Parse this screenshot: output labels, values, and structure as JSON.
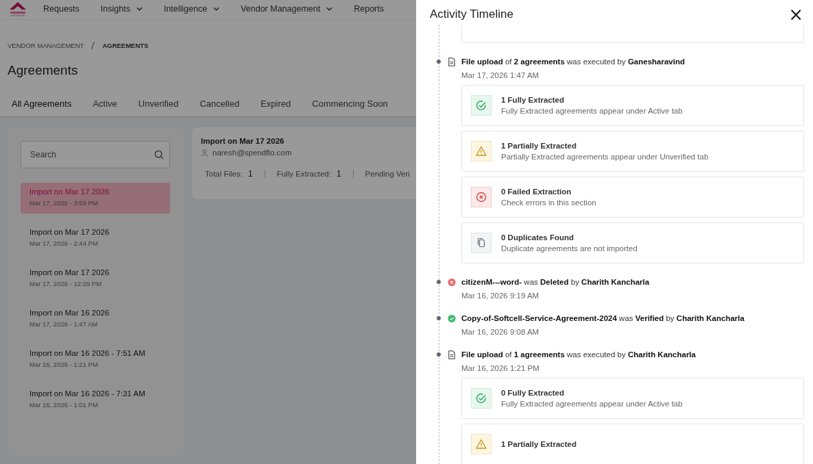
{
  "nav": {
    "items": [
      {
        "label": "Requests",
        "dropdown": false
      },
      {
        "label": "Insights",
        "dropdown": true
      },
      {
        "label": "Intelligence",
        "dropdown": true
      },
      {
        "label": "Vendor Management",
        "dropdown": true
      },
      {
        "label": "Reports",
        "dropdown": false
      }
    ]
  },
  "breadcrumb": [
    "VENDOR MANAGEMENT",
    "AGREEMENTS"
  ],
  "page_title": "Agreements",
  "tabs": [
    {
      "label": "All Agreements",
      "selected": true
    },
    {
      "label": "Active",
      "selected": false
    },
    {
      "label": "Unverified",
      "selected": false
    },
    {
      "label": "Cancelled",
      "selected": false
    },
    {
      "label": "Expired",
      "selected": false
    },
    {
      "label": "Commencing Soon",
      "selected": false
    }
  ],
  "search": {
    "placeholder": "Search"
  },
  "imports": [
    {
      "title": "Import on Mar 17 2026",
      "time": "Mar 17, 2026 - 3:59 PM",
      "selected": true
    },
    {
      "title": "Import on Mar 17 2026",
      "time": "Mar 17, 2026 - 2:44 PM",
      "selected": false
    },
    {
      "title": "Import on Mar 17 2026",
      "time": "Mar 17, 2026 - 12:29 PM",
      "selected": false
    },
    {
      "title": "Import on Mar 16 2026",
      "time": "Mar 17, 2026 - 1:47 AM",
      "selected": false
    },
    {
      "title": "Import on Mar 16 2026 - 7:51 AM",
      "time": "Mar 16, 2026 - 1:21 PM",
      "selected": false
    },
    {
      "title": "Import on Mar 16 2026 - 7:31 AM",
      "time": "Mar 16, 2026 - 1:01 PM",
      "selected": false
    }
  ],
  "detail": {
    "title": "Import on Mar 17 2026",
    "user": "naresh@spendflo.com",
    "stats": [
      {
        "label": "Total Files:",
        "value": "1"
      },
      {
        "label": "Fully Extracted:",
        "value": "1"
      },
      {
        "label": "Pending Veri"
      }
    ]
  },
  "drawer": {
    "title": "Activity Timeline",
    "close": "×",
    "events": [
      {
        "kind": "upload",
        "text": "**File upload** of **2 agreements** was executed by **Ganesharavind**",
        "time": "Mar 17, 2026 1:47 AM",
        "results": [
          {
            "kind": "success",
            "title": "1 Fully Extracted",
            "desc": "Fully Extracted agreements appear under Active tab"
          },
          {
            "kind": "partial",
            "title": "1 Partially Extracted",
            "desc": "Partially Extracted agreements appear under Unverified tab"
          },
          {
            "kind": "failed",
            "title": "0 Failed Extraction",
            "desc": "Check errors in this section"
          },
          {
            "kind": "duplicate",
            "title": "0 Duplicates Found",
            "desc": "Duplicate agreements are not imported"
          }
        ]
      },
      {
        "kind": "deleted",
        "text": "**citizenM---word-** was **Deleted** by **Charith Kancharla**",
        "time": "Mar 16, 2026 9:19 AM"
      },
      {
        "kind": "verified",
        "text": "**Copy-of-Softcell-Service-Agreement-2024** was **Verified** by **Charith Kancharla**",
        "time": "Mar 16, 2026 9:08 AM"
      },
      {
        "kind": "upload",
        "text": "**File upload** of **1 agreements** was executed by **Charith Kancharla**",
        "time": "Mar 16, 2026 1:21 PM",
        "results": [
          {
            "kind": "success",
            "title": "0 Fully Extracted",
            "desc": "Fully Extracted agreements appear under Active tab"
          },
          {
            "kind": "partial",
            "title": "1 Partially Extracted"
          }
        ]
      }
    ]
  }
}
